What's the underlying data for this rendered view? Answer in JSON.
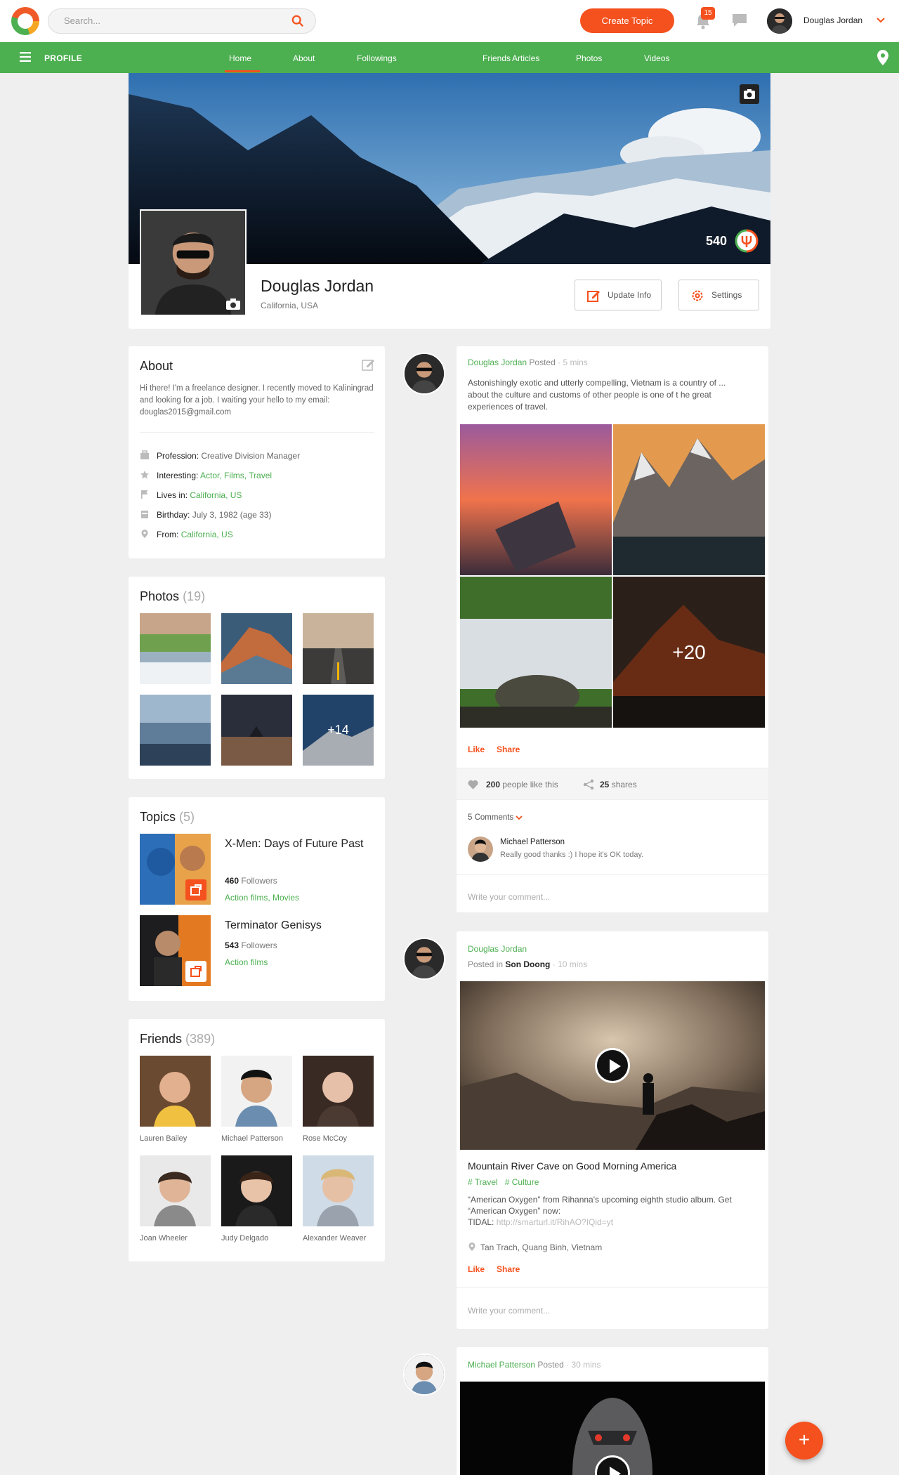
{
  "header": {
    "search_placeholder": "Search...",
    "create_topic": "Create Topic",
    "notif_count": "15",
    "user_name": "Douglas Jordan"
  },
  "nav": {
    "profile": "PROFILE",
    "links": [
      "Home",
      "About",
      "Followings",
      "Friends",
      "Articles",
      "Photos",
      "Videos"
    ]
  },
  "profile": {
    "name": "Douglas Jordan",
    "location": "California, USA",
    "score": "540",
    "update_info": "Update Info",
    "settings": "Settings"
  },
  "about": {
    "title": "About",
    "text": "Hi there! I'm a freelance designer. I recently moved to Kaliningrad and looking for a job. I waiting your hello to my email: douglas2015@gmail.com",
    "profession_label": "Profession:",
    "profession": "Creative Division Manager",
    "interesting_label": "Interesting:",
    "interesting": "Actor, Films, Travel",
    "lives_label": "Lives in:",
    "lives": "California, US",
    "birthday_label": "Birthday:",
    "birthday": "July 3, 1982 (age 33)",
    "from_label": "From:",
    "from": "California, US"
  },
  "photos": {
    "title": "Photos",
    "count": "(19)",
    "more": "+14"
  },
  "topics": {
    "title": "Topics",
    "count": "(5)",
    "items": [
      {
        "title": "X-Men: Days of Future Past",
        "followers_num": "460",
        "followers_label": "Followers",
        "tags": "Action films, Movies"
      },
      {
        "title": "Terminator Genisys",
        "followers_num": "543",
        "followers_label": "Followers",
        "tags": "Action films"
      }
    ]
  },
  "friends": {
    "title": "Friends",
    "count": "(389)",
    "names": [
      "Lauren Bailey",
      "Michael Patterson",
      "Rose McCoy",
      "Joan Wheeler",
      "Judy Delgado",
      "Alexander Weaver"
    ]
  },
  "post1": {
    "author": "Douglas Jordan",
    "verb": "Posted",
    "time": "5 mins",
    "text": "Astonishingly exotic and utterly compelling, Vietnam is a country of ... about the culture and customs of other people is one of t he great experiences of travel.",
    "more": "+20",
    "like": "Like",
    "share": "Share",
    "likes_num": "200",
    "likes_label": "people like this",
    "shares_num": "25",
    "shares_label": "shares",
    "comments": "5 Comments",
    "commenter": "Michael Patterson",
    "comment": "Really good thanks :) I hope it's OK today.",
    "write": "Write your comment..."
  },
  "post2": {
    "author": "Douglas Jordan",
    "posted_in": "Posted in",
    "place": "Son Doong",
    "time": "10 mins",
    "title": "Mountain River Cave on Good Morning America",
    "tag1": "# Travel",
    "tag2": "# Culture",
    "desc": "“American Oxygen” from Rihanna's upcoming eighth studio album. Get “American Oxygen” now:",
    "tidal_label": "TIDAL:",
    "tidal_link": "http://smarturl.it/RihAO?IQid=yt",
    "location": "Tan Trach, Quang Binh, Vietnam",
    "like": "Like",
    "share": "Share",
    "write": "Write your comment..."
  },
  "post3": {
    "author": "Michael Patterson",
    "verb": "Posted",
    "time": "30 mins"
  },
  "fab": "+"
}
